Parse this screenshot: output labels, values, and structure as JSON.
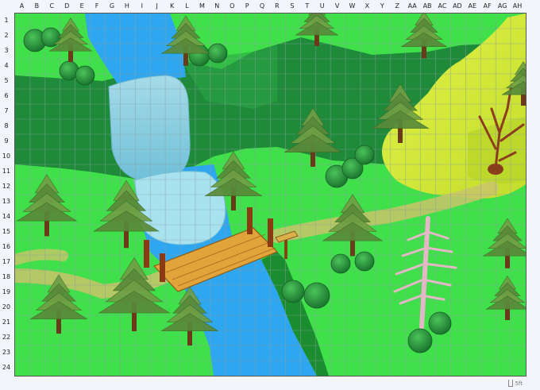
{
  "grid": {
    "columns": [
      "A",
      "B",
      "C",
      "D",
      "E",
      "F",
      "G",
      "H",
      "I",
      "J",
      "K",
      "L",
      "M",
      "N",
      "O",
      "P",
      "Q",
      "R",
      "S",
      "T",
      "U",
      "V",
      "W",
      "X",
      "Y",
      "Z",
      "AA",
      "AB",
      "AC",
      "AD",
      "AE",
      "AF",
      "AG",
      "AH"
    ],
    "rows": [
      "1",
      "2",
      "3",
      "4",
      "5",
      "6",
      "7",
      "8",
      "9",
      "10",
      "11",
      "12",
      "13",
      "14",
      "15",
      "16",
      "17",
      "18",
      "19",
      "20",
      "21",
      "22",
      "23",
      "24"
    ]
  },
  "scale": {
    "label": "5ft"
  },
  "colors": {
    "grass": "#3fe04a",
    "forest_floor": "#1f8a3a",
    "river": "#2ea6f0",
    "waterfall": "#8fd3e6",
    "path": "#c9c46a",
    "cliff_yellow": "#d6ee3a",
    "bridge": "#e0a43a",
    "grid_line": "#8aa0a0"
  },
  "icons": [
    "pine-tree-icon",
    "bush-icon",
    "dead-tree-icon",
    "bridge-icon",
    "signpost-icon",
    "waterfall-icon",
    "river-icon",
    "path-icon"
  ]
}
